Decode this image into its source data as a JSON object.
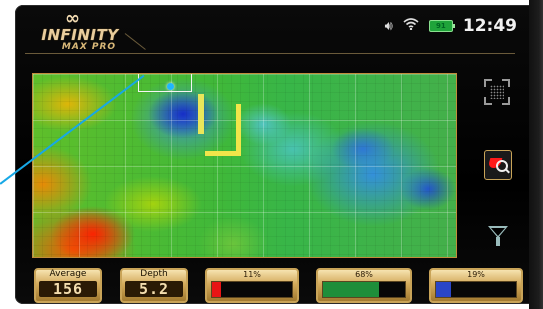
{
  "brand": {
    "logo_mark": "∞",
    "name": "INFINITY",
    "model": "MAX PRO"
  },
  "status_bar": {
    "volume_icon": "volume-icon",
    "wifi_icon": "wifi-icon",
    "battery_label": "91",
    "time": "12:49"
  },
  "readouts": {
    "average": {
      "label": "Average",
      "value": "156"
    },
    "depth": {
      "label": "Depth",
      "value": "5.2"
    }
  },
  "composition_bars": [
    {
      "label": "11%",
      "value": 0.11,
      "color": "#e81515"
    },
    {
      "label": "68%",
      "value": 0.68,
      "color": "#1e8e3a"
    },
    {
      "label": "19%",
      "value": 0.19,
      "color": "#2a46c8"
    }
  ],
  "side_tools": {
    "grid": "grid-view-icon",
    "search": "target-search-icon",
    "filter": "filter-icon"
  },
  "colors": {
    "accent_gold": "#c9a458",
    "pointer_line": "#17a8e6",
    "cursor_dot": "#1fb6ff"
  }
}
